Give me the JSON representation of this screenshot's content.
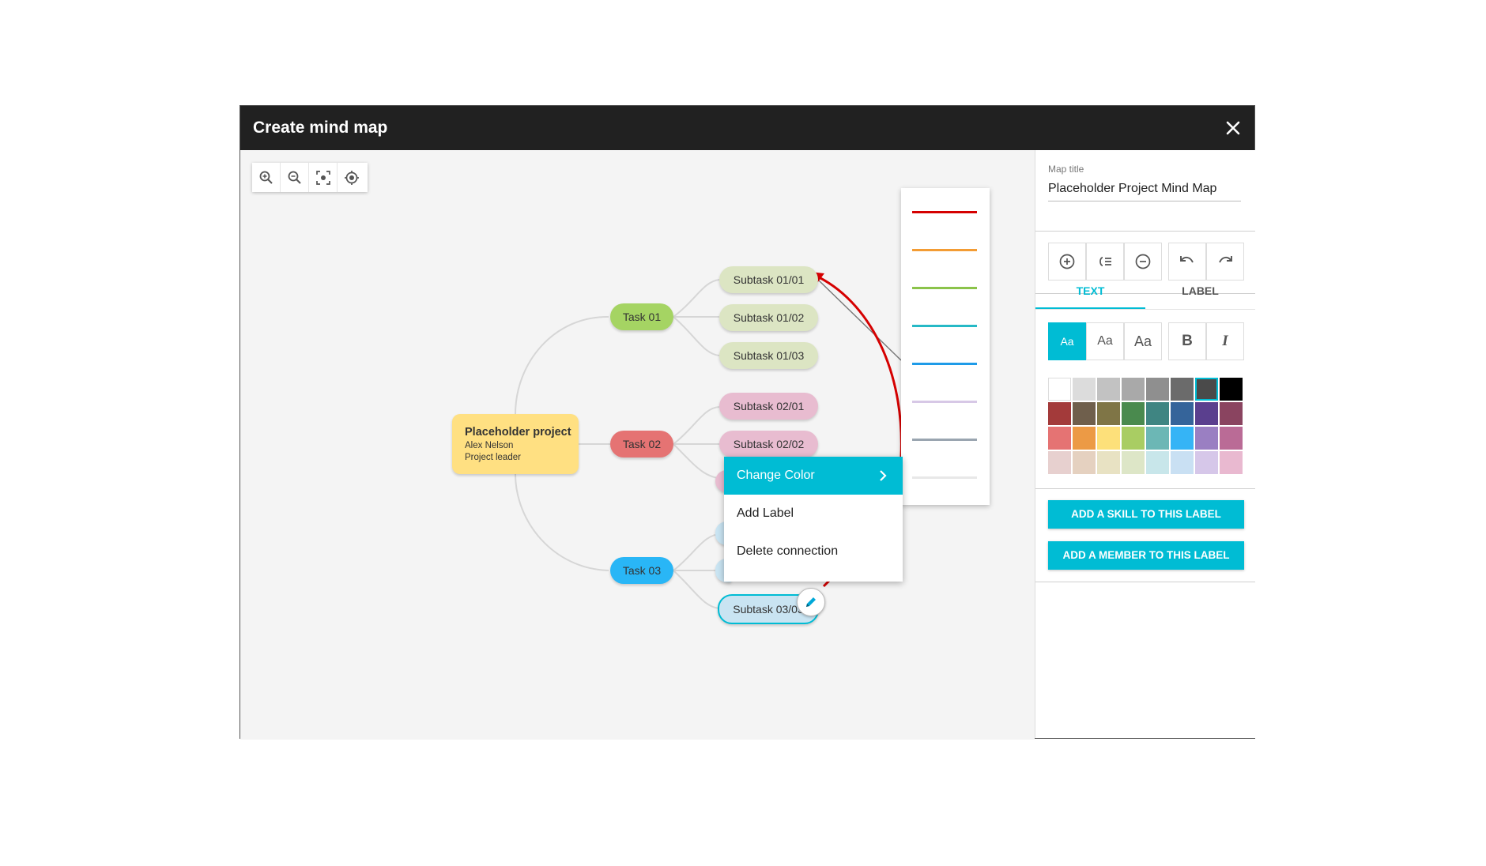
{
  "window": {
    "title": "Create mind map"
  },
  "mindmap": {
    "root": {
      "title": "Placeholder project",
      "line1": "Alex Nelson",
      "line2": "Project leader"
    },
    "tasks": [
      {
        "label": "Task 01",
        "color": "#a5d463"
      },
      {
        "label": "Task 02",
        "color": "#e57373"
      },
      {
        "label": "Task 03",
        "color": "#29b6f6"
      }
    ],
    "subtasks": [
      {
        "label": "Subtask 01/01",
        "color": "#dce5c3"
      },
      {
        "label": "Subtask 01/02",
        "color": "#dce5c3"
      },
      {
        "label": "Subtask 01/03",
        "color": "#dce5c3"
      },
      {
        "label": "Subtask 02/01",
        "color": "#e8bcd0"
      },
      {
        "label": "Subtask 02/02",
        "color": "#e8bcd0"
      },
      {
        "label": "Subtask 03/03",
        "color": "#c9e4f2"
      }
    ]
  },
  "context_menu": {
    "change_color": "Change Color",
    "add_label": "Add Label",
    "delete_connection": "Delete connection"
  },
  "line_colors": [
    "#d50000",
    "#f39c34",
    "#8bc34a",
    "#26b9c6",
    "#1e9be8",
    "#d7c8e6",
    "#9aa5b0",
    "#e8e8e8"
  ],
  "panel": {
    "map_title_label": "Map title",
    "map_title_value": "Placeholder Project Mind Map",
    "tabs": {
      "text": "TEXT",
      "label": "LABEL"
    },
    "font_buttons": [
      "Aa",
      "Aa",
      "Aa"
    ],
    "bold": "B",
    "italic": "I",
    "swatches": [
      [
        "#ffffff",
        "#dcdcdc",
        "#c2c2c2",
        "#a9a9a9",
        "#8f8f8f",
        "#6b6b6b",
        "#4a4a4a",
        "#000000"
      ],
      [
        "#a33a3a",
        "#6f5f4c",
        "#7f7546",
        "#4a8a4e",
        "#3f8582",
        "#35649a",
        "#5a3f8e",
        "#8a4460"
      ],
      [
        "#e57373",
        "#ec9a45",
        "#fde07a",
        "#a9cd63",
        "#6cb7b5",
        "#35b4f6",
        "#9a7fc2",
        "#ba6b96"
      ],
      [
        "#e7d0cf",
        "#e5d1c0",
        "#e8e2c3",
        "#dde6c7",
        "#c8e6ea",
        "#c9e0f3",
        "#d6c7e9",
        "#e9b9d0"
      ]
    ],
    "selected_swatch": "#4a4a4a",
    "add_skill": "ADD A SKILL TO THIS LABEL",
    "add_member": "ADD A MEMBER TO THIS LABEL"
  }
}
